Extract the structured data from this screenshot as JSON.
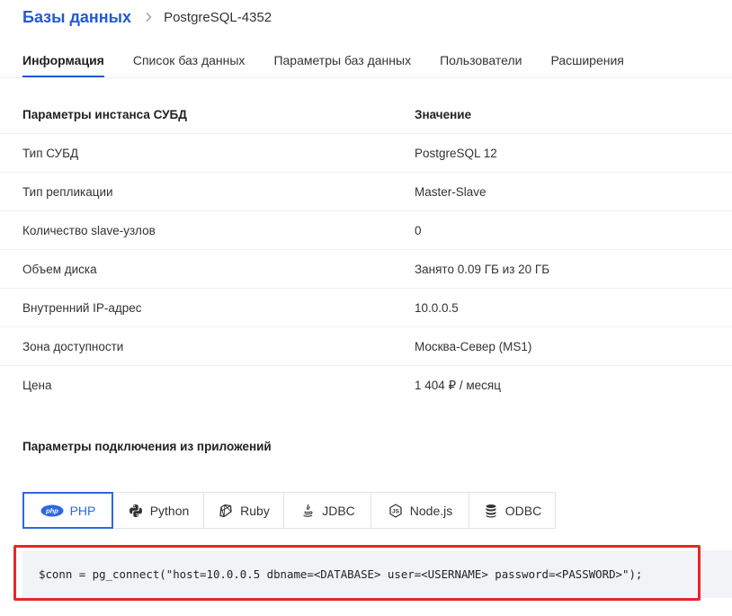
{
  "breadcrumb": {
    "parent": "Базы данных",
    "current": "PostgreSQL-4352"
  },
  "tabs": [
    {
      "label": "Информация",
      "active": true
    },
    {
      "label": "Список баз данных",
      "active": false
    },
    {
      "label": "Параметры баз данных",
      "active": false
    },
    {
      "label": "Пользователи",
      "active": false
    },
    {
      "label": "Расширения",
      "active": false
    }
  ],
  "instance_table": {
    "headers": [
      "Параметры инстанса СУБД",
      "Значение"
    ],
    "rows": [
      [
        "Тип СУБД",
        "PostgreSQL 12"
      ],
      [
        "Тип репликации",
        "Master-Slave"
      ],
      [
        "Количество slave-узлов",
        "0"
      ],
      [
        "Объем диска",
        "Занято 0.09 ГБ из 20 ГБ"
      ],
      [
        "Внутренний IP-адрес",
        "10.0.0.5"
      ],
      [
        "Зона доступности",
        "Москва-Север (MS1)"
      ],
      [
        "Цена",
        "1 404 ₽ / месяц"
      ]
    ]
  },
  "connection": {
    "title": "Параметры подключения из приложений",
    "languages": [
      {
        "label": "PHP",
        "icon": "php-icon",
        "icon_text": "php",
        "active": true
      },
      {
        "label": "Python",
        "icon": "python-icon",
        "active": false
      },
      {
        "label": "Ruby",
        "icon": "ruby-icon",
        "active": false
      },
      {
        "label": "JDBC",
        "icon": "java-icon",
        "active": false
      },
      {
        "label": "Node.js",
        "icon": "nodejs-icon",
        "active": false
      },
      {
        "label": "ODBC",
        "icon": "database-icon",
        "active": false
      }
    ],
    "code": "$conn = pg_connect(\"host=10.0.0.5 dbname=<DATABASE> user=<USERNAME> password=<PASSWORD>\");"
  },
  "colors": {
    "accent": "#1f5bd6",
    "highlight": "#e8262a",
    "code_bg": "#f1f3f6"
  }
}
